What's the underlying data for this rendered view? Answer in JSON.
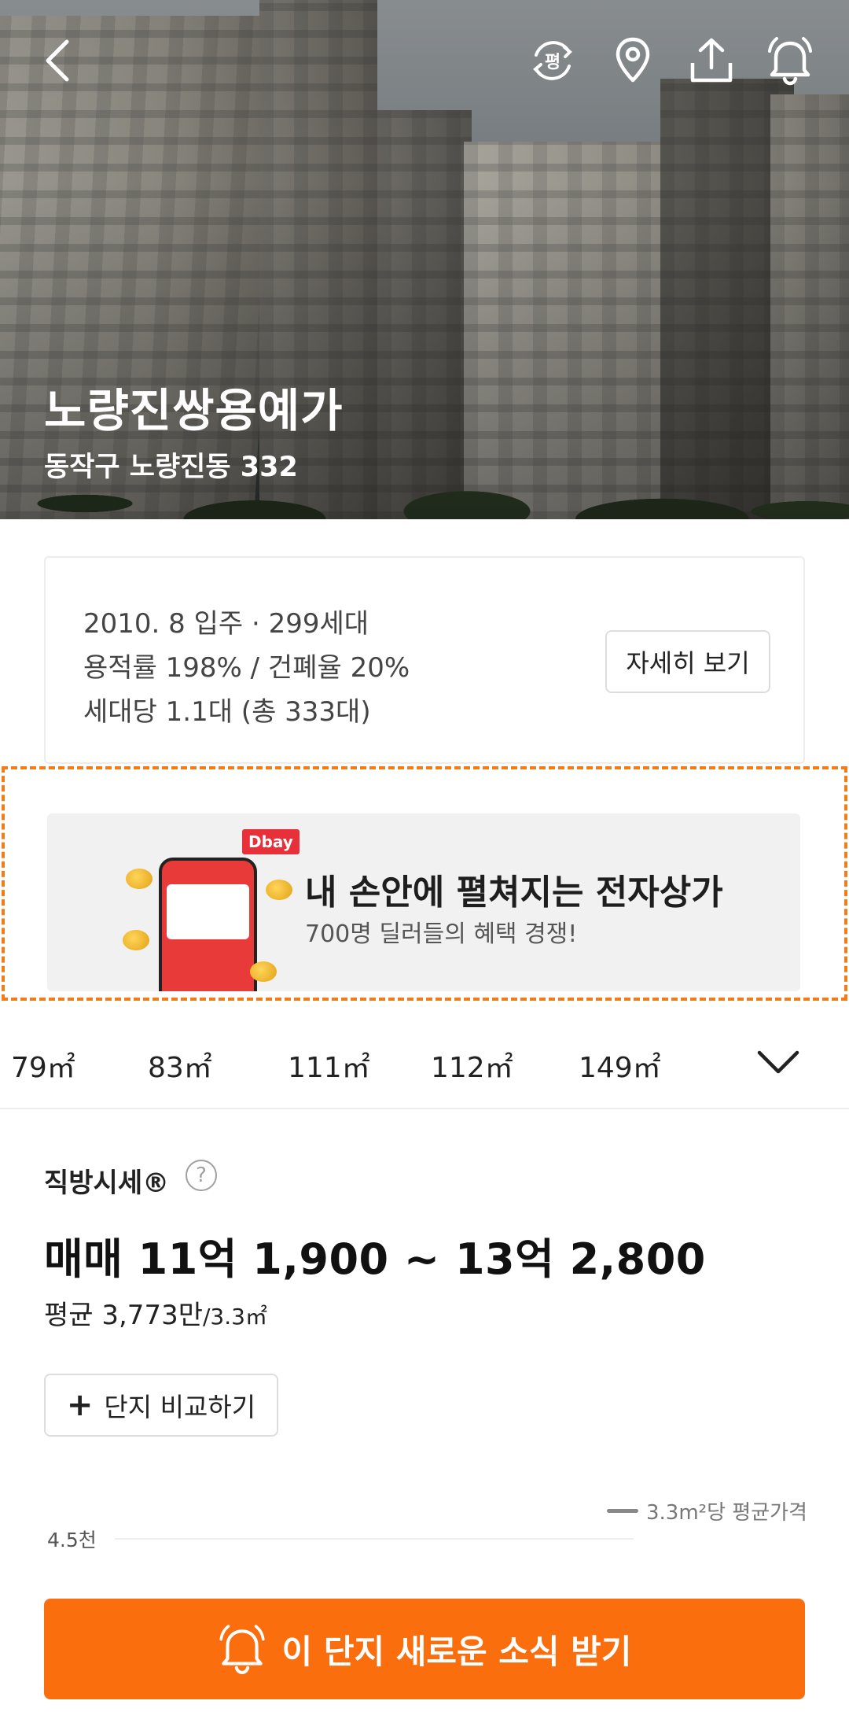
{
  "hero": {
    "title": "노량진쌍용예가",
    "address": "동작구 노량진동 332"
  },
  "toolbar": {
    "pyeong_label": "평"
  },
  "info": {
    "line1": "2010. 8 입주 · 299세대",
    "line2": "용적률 198% / 건폐율 20%",
    "line3": "세대당 1.1대 (총 333대)",
    "detail_button": "자세히 보기"
  },
  "ad": {
    "logo": "Dbay",
    "title": "내 손안에 펼쳐지는 전자상가",
    "subtitle": "700명 딜러들의 혜택 경쟁!"
  },
  "size_tabs": [
    "79㎡",
    "83㎡",
    "111㎡",
    "112㎡",
    "149㎡"
  ],
  "price": {
    "label": "직방시세®",
    "help": "?",
    "main": "매매 11억 1,900 ~ 13억 2,800",
    "avg_prefix": "평균 3,773만",
    "avg_unit": "/3.3㎡"
  },
  "compare_button": "단지 비교하기",
  "chart": {
    "legend": "3.3m²당 평균가격",
    "axis_tick": "4.5천"
  },
  "cta": {
    "label": "이 단지 새로운 소식 받기"
  },
  "colors": {
    "accent": "#fa6e0e",
    "ad_border": "#f07d1a"
  }
}
